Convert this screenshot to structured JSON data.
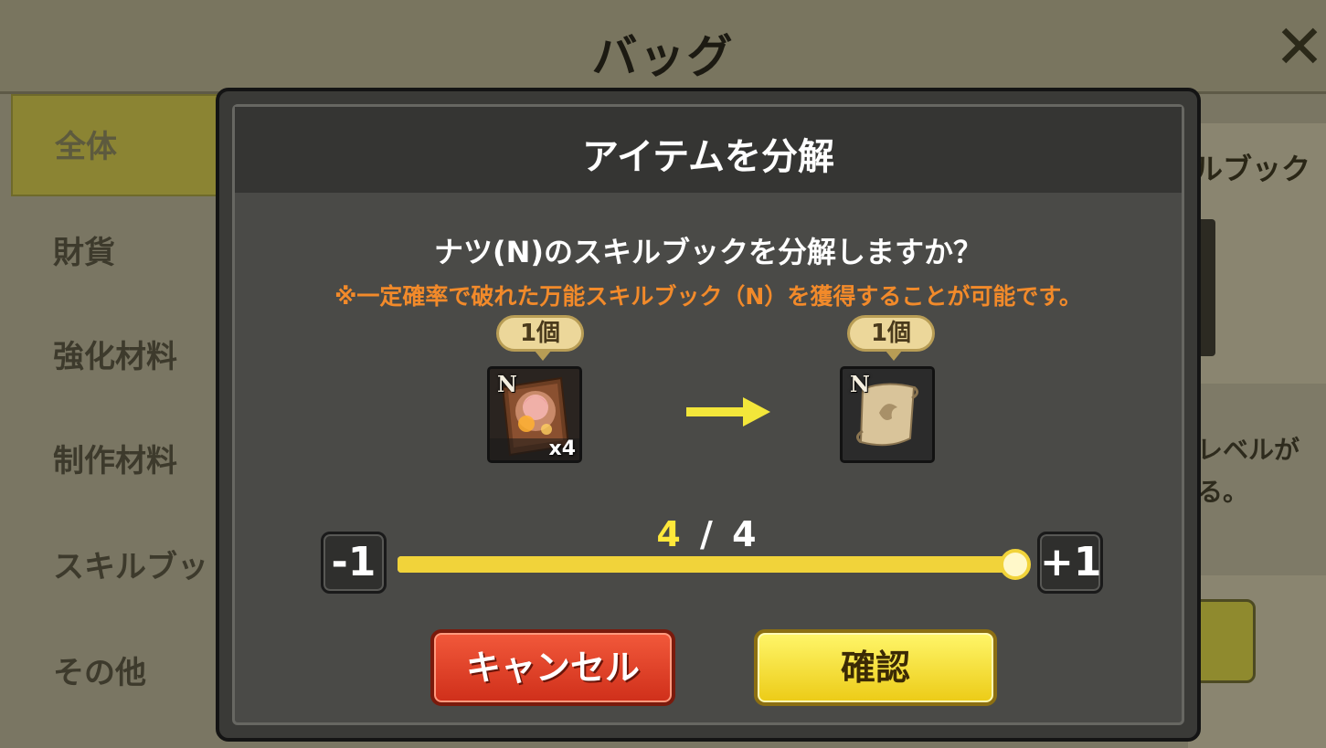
{
  "background": {
    "title": "バッグ",
    "close_glyph": "✕",
    "categories": [
      {
        "label": "全体",
        "active": true
      },
      {
        "label": "財貨",
        "active": false
      },
      {
        "label": "強化材料",
        "active": false
      },
      {
        "label": "制作材料",
        "active": false
      },
      {
        "label": "スキルブッ",
        "active": false
      },
      {
        "label": "その他",
        "active": false
      }
    ],
    "peek_title": "ルブック",
    "peek_desc": "レベルが\nる。"
  },
  "dialog": {
    "title": "アイテムを分解",
    "question": "ナツ(N)のスキルブックを分解しますか？",
    "note": "※一定確率で破れた万能スキルブック（N）を獲得することが可能です。",
    "source_item": {
      "count_label": "1個",
      "rank": "N",
      "owned": "x4",
      "icon": "skillbook-icon"
    },
    "result_item": {
      "count_label": "1個",
      "rank": "N",
      "icon": "scroll-icon"
    },
    "current": "4",
    "separator": "/",
    "max": "4",
    "slider_fraction": 1.0,
    "minus_label": "-1",
    "plus_label": "+1",
    "cancel_label": "キャンセル",
    "confirm_label": "確認"
  },
  "colors": {
    "note": "#f28a2a",
    "slider": "#f1d33a",
    "cancel": "#e0412a",
    "confirm": "#f6e037"
  }
}
